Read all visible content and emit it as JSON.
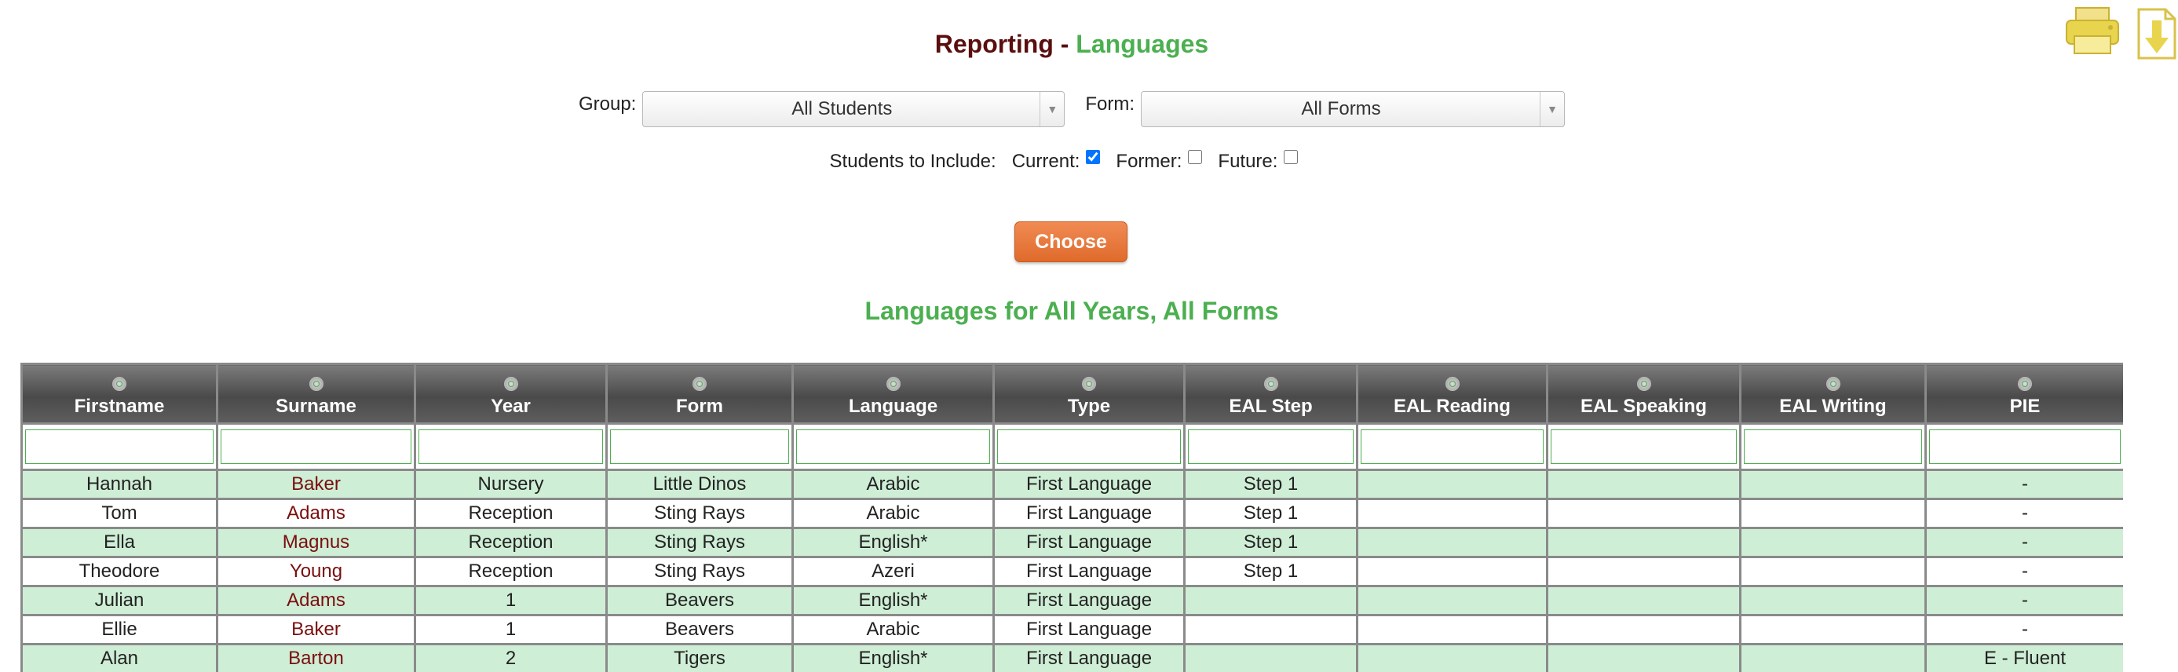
{
  "page": {
    "title_main": "Reporting",
    "title_dash": " - ",
    "title_accent": "Languages",
    "subtitle": "Languages for All Years, All Forms"
  },
  "toolbar": {
    "print_icon": "print-icon",
    "download_icon": "download-icon"
  },
  "filters": {
    "group_label": "Group:",
    "group_value": "All Students",
    "form_label": "Form:",
    "form_value": "All Forms",
    "students_label": "Students to Include:",
    "current_label": "Current:",
    "current_checked": true,
    "former_label": "Former:",
    "former_checked": false,
    "future_label": "Future:",
    "future_checked": false,
    "choose_label": "Choose"
  },
  "table": {
    "columns": [
      "Firstname",
      "Surname",
      "Year",
      "Form",
      "Language",
      "Type",
      "EAL Step",
      "EAL Reading",
      "EAL Speaking",
      "EAL Writing",
      "PIE"
    ],
    "rows": [
      [
        "Hannah",
        "Baker",
        "Nursery",
        "Little Dinos",
        "Arabic",
        "First Language",
        "Step 1",
        "",
        "",
        "",
        "-"
      ],
      [
        "Tom",
        "Adams",
        "Reception",
        "Sting Rays",
        "Arabic",
        "First Language",
        "Step 1",
        "",
        "",
        "",
        "-"
      ],
      [
        "Ella",
        "Magnus",
        "Reception",
        "Sting Rays",
        "English*",
        "First Language",
        "Step 1",
        "",
        "",
        "",
        "-"
      ],
      [
        "Theodore",
        "Young",
        "Reception",
        "Sting Rays",
        "Azeri",
        "First Language",
        "Step 1",
        "",
        "",
        "",
        "-"
      ],
      [
        "Julian",
        "Adams",
        "1",
        "Beavers",
        "English*",
        "First Language",
        "",
        "",
        "",
        "",
        "-"
      ],
      [
        "Ellie",
        "Baker",
        "1",
        "Beavers",
        "Arabic",
        "First Language",
        "",
        "",
        "",
        "",
        "-"
      ],
      [
        "Alan",
        "Barton",
        "2",
        "Tigers",
        "English*",
        "First Language",
        "",
        "",
        "",
        "",
        "E - Fluent"
      ]
    ]
  },
  "colors": {
    "title_dark": "#5a0e0e",
    "accent_green": "#4caf50",
    "button_orange": "#e8773a",
    "row_green": "#cfeed6",
    "surname_red": "#7a0f0f"
  }
}
